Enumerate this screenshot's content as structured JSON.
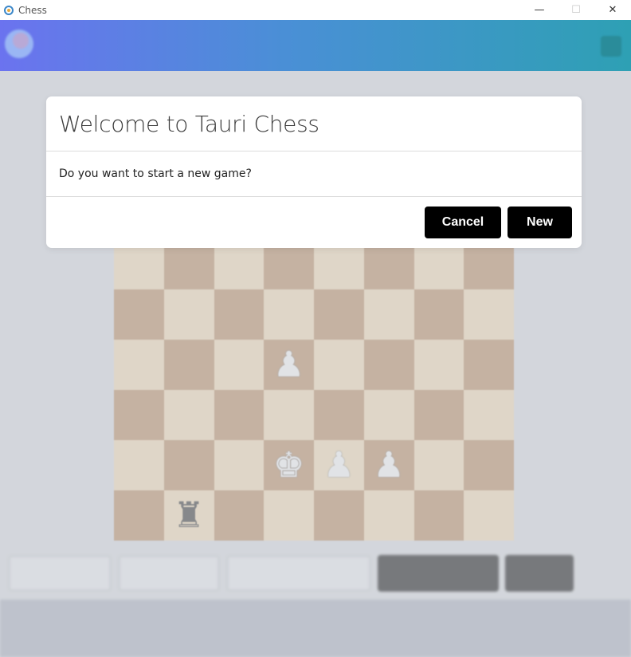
{
  "window": {
    "title": "Chess",
    "minimize_glyph": "—",
    "maximize_glyph": "☐",
    "close_glyph": "✕"
  },
  "dialog": {
    "title": "Welcome to Tauri Chess",
    "message": "Do you want to start a new game?",
    "cancel_label": "Cancel",
    "new_label": "New"
  },
  "board": {
    "pieces": [
      {
        "row": 2,
        "col": 3,
        "glyph": "♟",
        "color": "white",
        "name": "white-pawn"
      },
      {
        "row": 4,
        "col": 3,
        "glyph": "♚",
        "color": "white",
        "name": "white-king"
      },
      {
        "row": 4,
        "col": 4,
        "glyph": "♟",
        "color": "white",
        "name": "white-pawn"
      },
      {
        "row": 4,
        "col": 5,
        "glyph": "♟",
        "color": "white",
        "name": "white-pawn"
      },
      {
        "row": 5,
        "col": 1,
        "glyph": "♜",
        "color": "black",
        "name": "black-rook"
      }
    ]
  },
  "colors": {
    "light_square": "#efd8b1",
    "dark_square": "#b5875d",
    "button_bg": "#000000"
  }
}
